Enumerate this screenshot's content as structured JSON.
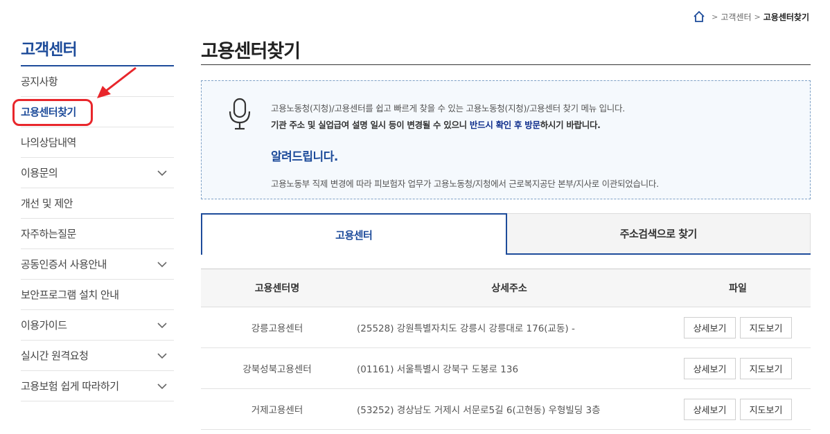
{
  "breadcrumb": {
    "home_icon": "home-icon",
    "items": [
      "고객센터",
      "고용센터찾기"
    ]
  },
  "sidebar": {
    "title": "고객센터",
    "items": [
      {
        "label": "공지사항",
        "expandable": false
      },
      {
        "label": "고용센터찾기",
        "expandable": false,
        "active": true
      },
      {
        "label": "나의상담내역",
        "expandable": false
      },
      {
        "label": "이용문의",
        "expandable": true
      },
      {
        "label": "개선 및 제안",
        "expandable": false
      },
      {
        "label": "자주하는질문",
        "expandable": false
      },
      {
        "label": "공동인증서 사용안내",
        "expandable": true
      },
      {
        "label": "보안프로그램 설치 안내",
        "expandable": false
      },
      {
        "label": "이용가이드",
        "expandable": true
      },
      {
        "label": "실시간 원격요청",
        "expandable": true
      },
      {
        "label": "고용보험 쉽게 따라하기",
        "expandable": true
      }
    ]
  },
  "main": {
    "title": "고용센터찾기",
    "notice": {
      "icon": "microphone-icon",
      "line1": "고용노동청(지청)/고용센터를 쉽고 빠르게 찾을 수 있는 고용노동청(지청)/고용센터 찾기 메뉴 입니다.",
      "line2_pre": "기관 주소 및 실업급여 설명 일시 등이 변경될 수 있으니 ",
      "line2_emph": "반드시 확인 후 방문",
      "line2_post": "하시기 바랍니다.",
      "heading": "알려드립니다.",
      "line3": "고용노동부 직제 변경에 따라 피보험자 업무가 고용노동청/지청에서 근로복지공단 본부/지사로 이관되었습니다."
    },
    "tabs": [
      {
        "label": "고용센터",
        "active": true
      },
      {
        "label": "주소검색으로 찾기",
        "active": false
      }
    ],
    "table": {
      "headers": [
        "고용센터명",
        "상세주소",
        "파일"
      ],
      "rows": [
        {
          "name": "강릉고용센터",
          "address": "(25528) 강원특별자치도 강릉시 강릉대로 176(교동) -",
          "btn1": "상세보기",
          "btn2": "지도보기"
        },
        {
          "name": "강북성북고용센터",
          "address": "(01161) 서울특별시 강북구 도봉로 136",
          "btn1": "상세보기",
          "btn2": "지도보기"
        },
        {
          "name": "거제고용센터",
          "address": "(53252) 경상남도 거제시 서문로5길 6(고현동) 우형빌딩 3층",
          "btn1": "상세보기",
          "btn2": "지도보기"
        }
      ]
    }
  },
  "colors": {
    "brand": "#1d4b9a",
    "annotation": "#e8262b",
    "notice_bg": "#f5f9fd"
  }
}
